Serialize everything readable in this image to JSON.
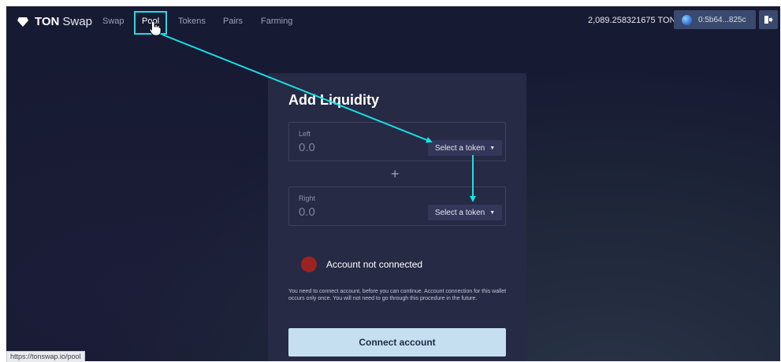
{
  "app": {
    "logo_bold": "TON",
    "logo_light": "Swap"
  },
  "nav": {
    "items": [
      {
        "label": "Swap"
      },
      {
        "label": "Pool",
        "active": true
      },
      {
        "label": "Tokens"
      },
      {
        "label": "Pairs"
      },
      {
        "label": "Farming"
      }
    ]
  },
  "header": {
    "balance": "2,089.258321675 TON",
    "wallet_address": "0:5b64...825c"
  },
  "card": {
    "title": "Add Liquidity",
    "left": {
      "label": "Left",
      "amount": "0.0",
      "select_label": "Select a token"
    },
    "right": {
      "label": "Right",
      "amount": "0.0",
      "select_label": "Select a token"
    },
    "plus": "+",
    "status": "Account not connected",
    "info": "You need to connect account, before you can continue. Account connection for this wallet occurs only once. You will not need to go through this procedure in the future.",
    "connect_label": "Connect account"
  },
  "browser": {
    "status_url": "https://tonswap.io/pool"
  },
  "colors": {
    "accent_annotation": "#19e0e6",
    "status_error": "#9b2420",
    "button_primary": "#c5dff0"
  }
}
